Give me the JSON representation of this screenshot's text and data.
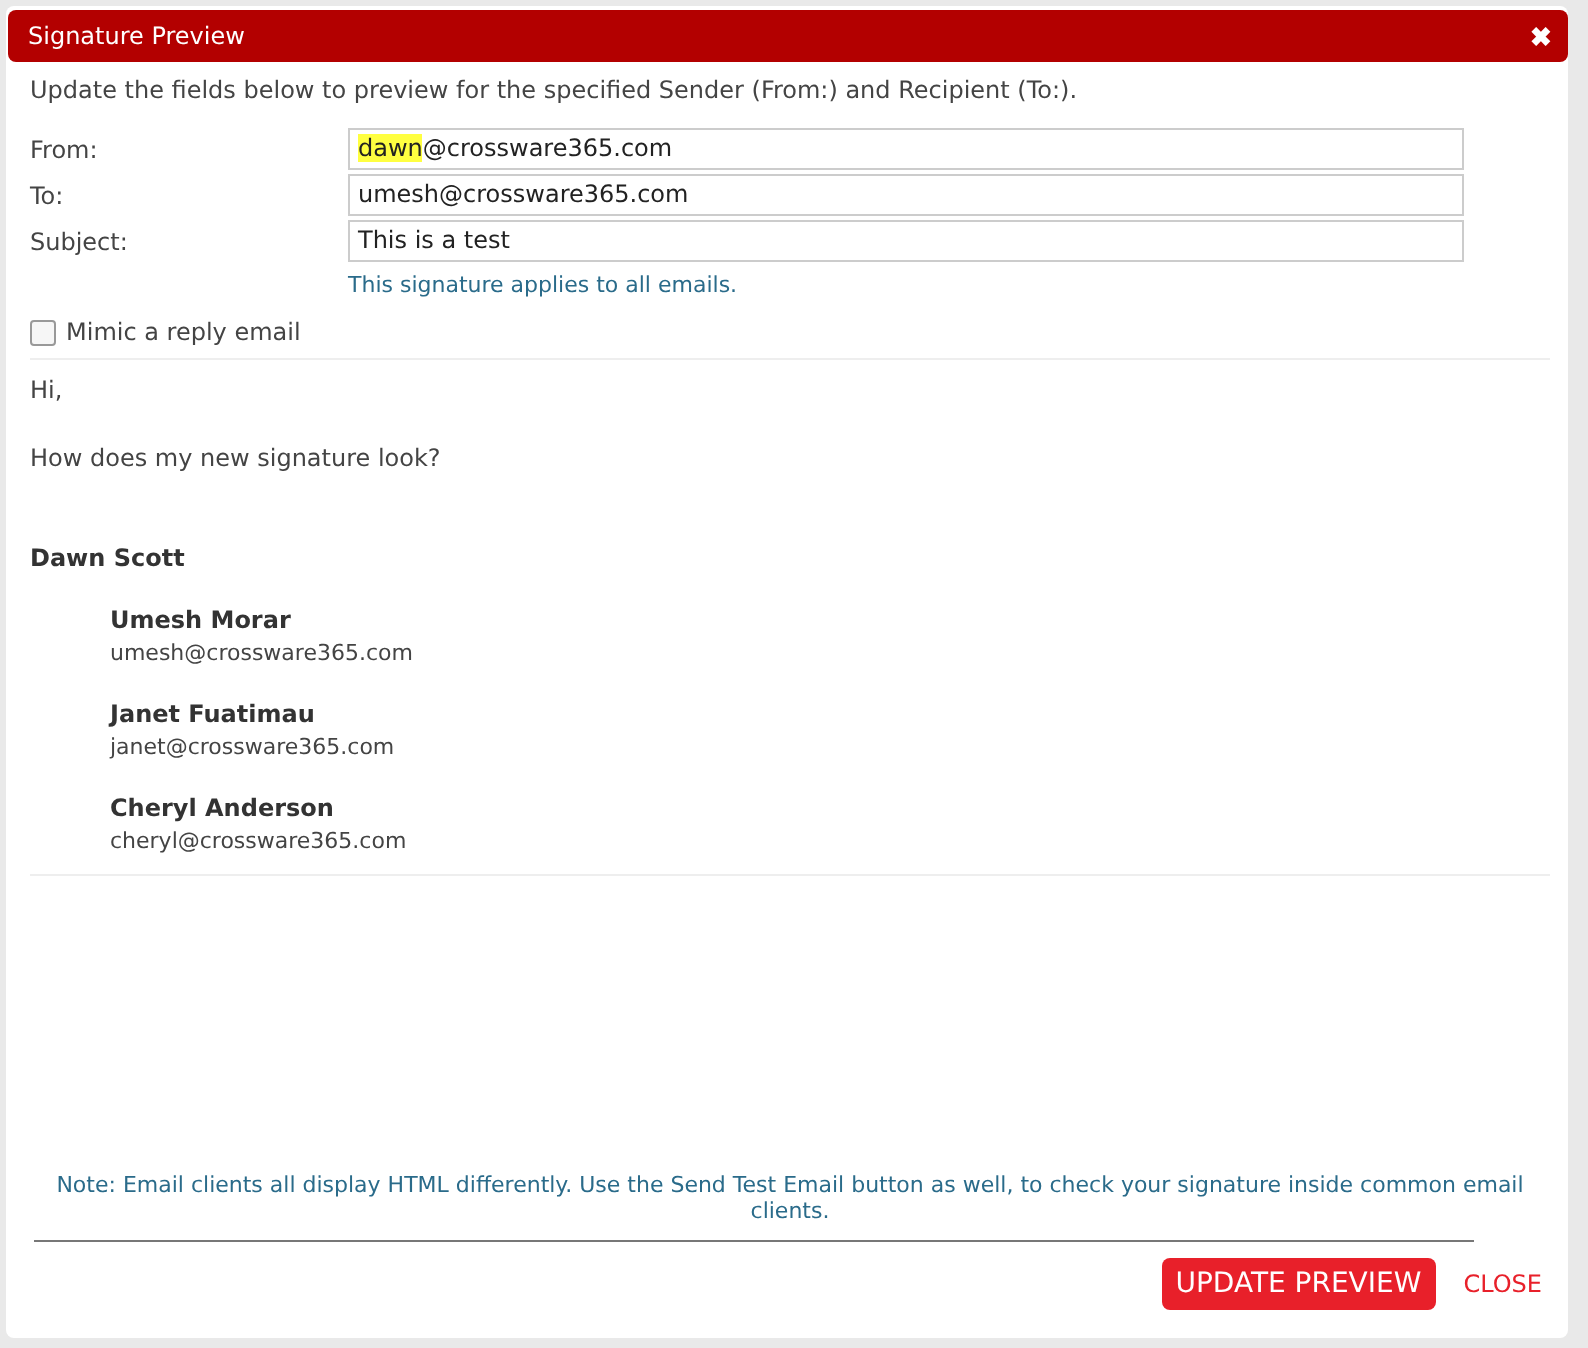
{
  "dialog": {
    "title": "Signature Preview",
    "close_icon": "✖"
  },
  "intro": "Update the fields below to preview for the specified Sender (From:) and Recipient (To:).",
  "fields": [
    {
      "label": "From:",
      "value_parts": [
        {
          "text": "dawn",
          "highlighted": true
        },
        {
          "text": "@crossware365.com",
          "highlighted": false
        }
      ]
    },
    {
      "label": "To:",
      "value_parts": [
        {
          "text": "umesh@crossware365.com",
          "highlighted": false
        }
      ]
    },
    {
      "label": "Subject:",
      "value_parts": [
        {
          "text": "This is a test",
          "highlighted": false
        }
      ]
    }
  ],
  "hint": "This signature applies to all emails.",
  "mimic_reply": {
    "label": "Mimic a reply email",
    "checked": false
  },
  "preview": {
    "greeting": "Hi,",
    "body": "How does my new signature look?",
    "sender": "Dawn Scott",
    "contacts": [
      {
        "name": "Umesh Morar",
        "email": "umesh@crossware365.com"
      },
      {
        "name": "Janet Fuatimau",
        "email": "janet@crossware365.com"
      },
      {
        "name": "Cheryl Anderson",
        "email": "cheryl@crossware365.com"
      }
    ]
  },
  "note": "Note: Email clients all display HTML differently. Use the Send Test Email button as well, to check your signature inside common email clients.",
  "buttons": {
    "primary": "UPDATE PREVIEW",
    "secondary": "CLOSE"
  }
}
